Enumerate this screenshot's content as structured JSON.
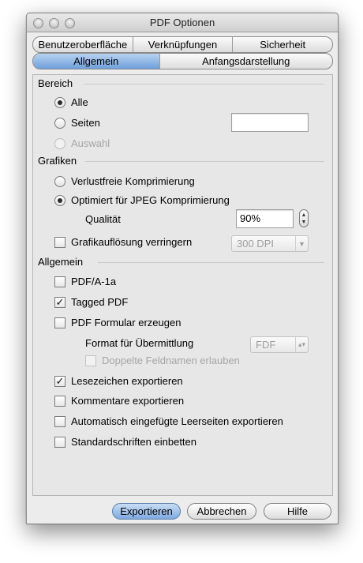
{
  "window": {
    "title": "PDF Optionen"
  },
  "tabs_row1": [
    "Benutzeroberfläche",
    "Verknüpfungen",
    "Sicherheit"
  ],
  "tabs_row2": [
    "Allgemein",
    "Anfangsdarstellung"
  ],
  "active_tab": "Allgemein",
  "bereich": {
    "heading": "Bereich",
    "alle": "Alle",
    "seiten": "Seiten",
    "seiten_value": "",
    "auswahl": "Auswahl",
    "selected": "Alle"
  },
  "grafiken": {
    "heading": "Grafiken",
    "verlustfrei": "Verlustfreie Komprimierung",
    "jpeg": "Optimiert für JPEG Komprimierung",
    "qualitaet_label": "Qualität",
    "qualitaet_value": "90%",
    "aufloesung_label": "Grafikauflösung verringern",
    "aufloesung_value": "300 DPI",
    "selected": "Optimiert für JPEG Komprimierung"
  },
  "allgemein": {
    "heading": "Allgemein",
    "pdfa": "PDF/A-1a",
    "tagged": "Tagged PDF",
    "formular": "PDF Formular erzeugen",
    "format_label": "Format für Übermittlung",
    "format_value": "FDF",
    "doppelte": "Doppelte Feldnamen erlauben",
    "lesezeichen": "Lesezeichen exportieren",
    "kommentare": "Kommentare exportieren",
    "leerseiten": "Automatisch eingefügte Leerseiten exportieren",
    "schriften": "Standardschriften einbetten"
  },
  "buttons": {
    "exportieren": "Exportieren",
    "abbrechen": "Abbrechen",
    "hilfe": "Hilfe"
  },
  "icons": {
    "check": "✓",
    "up_arrow": "▲",
    "down_arrow": "▼"
  }
}
